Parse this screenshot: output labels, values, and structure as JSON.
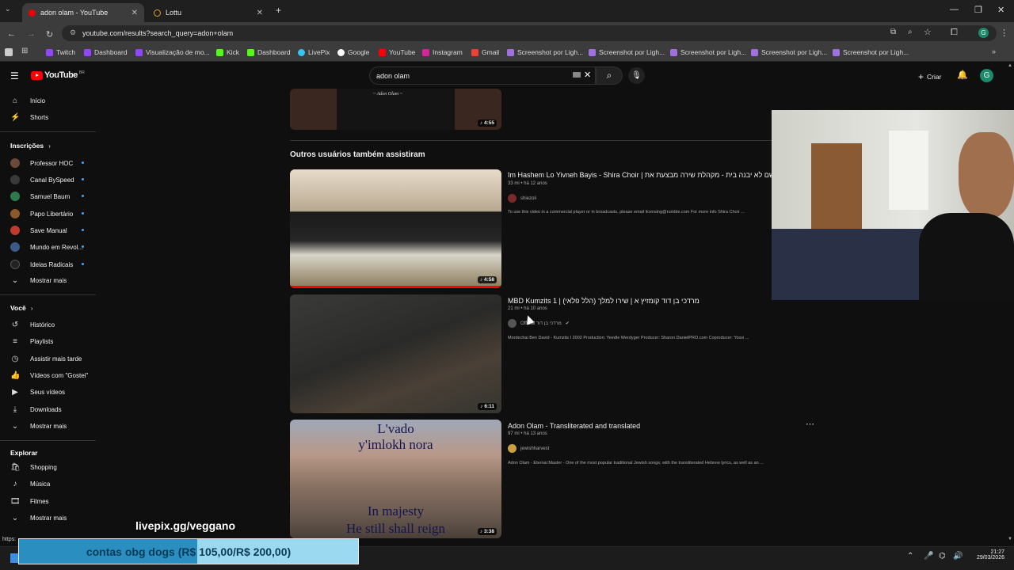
{
  "browser": {
    "tabs": [
      {
        "title": "adon olam - YouTube",
        "active": true
      },
      {
        "title": "Lottu",
        "active": false
      }
    ],
    "url": "youtube.com/results?search_query=adon+olam",
    "bookmarks": [
      "Twitch",
      "Dashboard",
      "Visualização de mo...",
      "Kick",
      "Dashboard",
      "LivePix",
      "Google",
      "YouTube",
      "Instagram",
      "Gmail",
      "Screenshot por Ligh...",
      "Screenshot por Ligh...",
      "Screenshot por Ligh...",
      "Screenshot por Ligh...",
      "Screenshot por Ligh..."
    ],
    "status_url": "https:"
  },
  "youtube": {
    "logo": "YouTube",
    "country": "BR",
    "search_value": "adon olam",
    "create_label": "Criar",
    "avatar_letter": "G"
  },
  "sidebar": {
    "main": [
      {
        "label": "Início",
        "icon": "home-icon"
      },
      {
        "label": "Shorts",
        "icon": "shorts-icon"
      }
    ],
    "subs_title": "Inscrições",
    "subscriptions": [
      {
        "label": "Professor HOC",
        "color": "#6b4a3a"
      },
      {
        "label": "Canal BySpeed",
        "color": "#3a3a3a"
      },
      {
        "label": "Samuel Baum",
        "color": "#2f7a4a"
      },
      {
        "label": "Papo Libertário",
        "color": "#8a5a2a"
      },
      {
        "label": "Save Manual",
        "color": "#c0392b"
      },
      {
        "label": "Mundo em Revol...",
        "color": "#3a5a8a"
      },
      {
        "label": "Ideias Radicais",
        "color": "#222222"
      }
    ],
    "subs_more": "Mostrar mais",
    "you_title": "Você",
    "you": [
      {
        "label": "Histórico",
        "icon": "history-icon"
      },
      {
        "label": "Playlists",
        "icon": "playlists-icon"
      },
      {
        "label": "Assistir mais tarde",
        "icon": "watch-later-icon"
      },
      {
        "label": "Vídeos com \"Gostei\"",
        "icon": "liked-videos-icon"
      },
      {
        "label": "Seus vídeos",
        "icon": "your-videos-icon"
      },
      {
        "label": "Downloads",
        "icon": "downloads-icon"
      }
    ],
    "you_more": "Mostrar mais",
    "explore_title": "Explorar",
    "explore": [
      {
        "label": "Shopping",
        "icon": "shopping-icon"
      },
      {
        "label": "Música",
        "icon": "music-icon"
      },
      {
        "label": "Filmes",
        "icon": "films-icon"
      }
    ],
    "explore_more": "Mostrar mais"
  },
  "results": {
    "first_thumb_duration": "4:55",
    "first_thumb_caption": "~ Adon Olam ~",
    "section_title": "Outros usuários também assistiram",
    "videos": [
      {
        "title": "Im Hashem Lo Yivneh Bayis - Shira Choir | אם השם לא יבנה בית - מקהלת שירה מבצעת את",
        "meta": "33 mi • há 12 anos",
        "channel": "shiezoli",
        "desc": "To use this video in a commercial player or in broadcasts, please email licensing@rumble.com For more info Shira Choir ...",
        "duration": "4:58",
        "avatar_color": "#7a2a2a"
      },
      {
        "title": "MBD Kumzits 1 | מרדכי בן דוד קומזיץ א | שירו למלך (הלל פלאי)",
        "meta": "21 mi • há 10 anos",
        "channel": "Official מרדכי בן דוד",
        "desc": "Mordechai Ben David - Kumzits I 2002 Production: Yeedle Werdyger Producer: Sharon DanielPRO.com Coproducer: Yossi ...",
        "duration": "6:11",
        "avatar_color": "#555555"
      },
      {
        "title": "Adon Olam - Transliterated and translated",
        "meta": "97 mi • há 13 anos",
        "channel": "jewishharvest",
        "desc": "Adon Olam - Eternal Master - One of the most popular traditional Jewish songs; with the transliterated Hebrew lyrics, as well as an ...",
        "duration": "3:38",
        "avatar_color": "#c8a040",
        "thumb_text": [
          "L'vado",
          "y'imlokh nora",
          "In majesty",
          "He still shall reign"
        ]
      }
    ]
  },
  "stream_overlay": {
    "watermark": "livepix.gg/veggano",
    "goal_text": "contas obg dogs (R$ 105,00/R$ 200,00)",
    "goal_progress": 0.525
  },
  "taskbar": {
    "time": "21:27",
    "date": "29/03/2026"
  }
}
